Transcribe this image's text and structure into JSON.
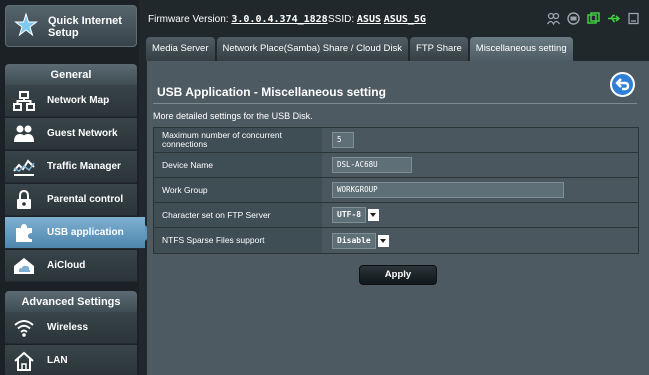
{
  "sidebar": {
    "quick_setup": "Quick Internet Setup",
    "general_header": "General",
    "general_items": [
      {
        "label": "Network Map",
        "icon": "network-map-icon"
      },
      {
        "label": "Guest Network",
        "icon": "guest-network-icon"
      },
      {
        "label": "Traffic Manager",
        "icon": "traffic-manager-icon"
      },
      {
        "label": "Parental control",
        "icon": "lock-icon"
      },
      {
        "label": "USB application",
        "icon": "puzzle-icon",
        "active": true
      },
      {
        "label": "AiCloud",
        "icon": "cloud-house-icon"
      }
    ],
    "advanced_header": "Advanced Settings",
    "advanced_items": [
      {
        "label": "Wireless",
        "icon": "wifi-icon"
      },
      {
        "label": "LAN",
        "icon": "home-icon"
      }
    ]
  },
  "topbar": {
    "firmware_label": "Firmware Version:",
    "firmware_value": "3.0.0.4.374_1828",
    "ssid_label": "SSID:",
    "ssid_1": "ASUS",
    "ssid_2": "ASUS_5G"
  },
  "tabs": [
    {
      "label": "Media Server"
    },
    {
      "label": "Network Place(Samba) Share / Cloud Disk"
    },
    {
      "label": "FTP Share"
    },
    {
      "label": "Miscellaneous setting",
      "active": true
    }
  ],
  "main": {
    "title": "USB Application - Miscellaneous setting",
    "description": "More detailed settings for the USB Disk.",
    "settings": [
      {
        "label": "Maximum number of concurrent connections",
        "value": "5"
      },
      {
        "label": "Device Name",
        "value": "DSL-AC68U"
      },
      {
        "label": "Work Group",
        "value": "WORKGROUP"
      },
      {
        "label": "Character set on FTP Server",
        "value": "UTF-8"
      },
      {
        "label": "NTFS Sparse Files support",
        "value": "Disable"
      }
    ],
    "apply_label": "Apply"
  },
  "colors": {
    "accent": "#5f95b9",
    "panel": "#4d5a62",
    "background": "#21282b"
  }
}
